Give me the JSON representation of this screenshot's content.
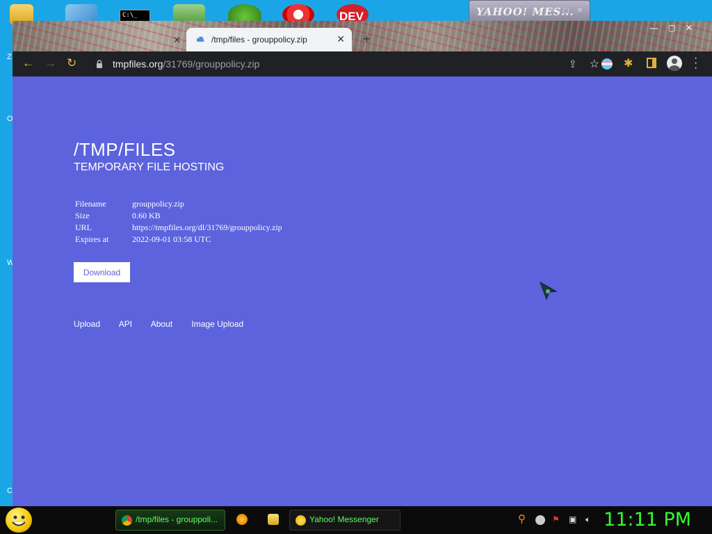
{
  "desktop": {
    "icons": [
      "folder-icon",
      "flash-icon",
      "terminal-icon",
      "home-icon",
      "frog-icon",
      "flame-icon",
      "dev-icon"
    ],
    "dev_label": "DEV",
    "terminal_label": "C:\\_",
    "left_glyphs": [
      "Z",
      "O",
      "W",
      "C"
    ]
  },
  "yahoo_window": {
    "title": "YAHOO! MES..."
  },
  "browser": {
    "tabs": [
      {
        "title": "",
        "active": false
      },
      {
        "title": "/tmp/files - grouppolicy.zip",
        "active": true
      }
    ],
    "url": {
      "host": "tmpfiles.org",
      "path": "/31769/grouppolicy.zip"
    }
  },
  "page": {
    "title": "/TMP/FILES",
    "subtitle": "TEMPORARY FILE HOSTING",
    "file_info": [
      {
        "key": "Filename",
        "value": "grouppolicy.zip"
      },
      {
        "key": "Size",
        "value": "0.60 KB"
      },
      {
        "key": "URL",
        "value": "https://tmpfiles.org/dl/31769/grouppolicy.zip"
      },
      {
        "key": "Expires at",
        "value": "2022-09-01 03:58 UTC"
      }
    ],
    "download_label": "Download",
    "footer_links": [
      "Upload",
      "API",
      "About",
      "Image Upload"
    ]
  },
  "taskbar": {
    "tasks": [
      {
        "label": "/tmp/files - grouppoli...",
        "icon": "chrome-icon"
      },
      {
        "label": "Yahoo! Messenger",
        "icon": "yahoo-icon"
      }
    ],
    "clock": "11:11 PM"
  },
  "colors": {
    "page_bg": "#5c63dc",
    "clock": "#2fff2f",
    "task_text": "#5cff5c"
  }
}
